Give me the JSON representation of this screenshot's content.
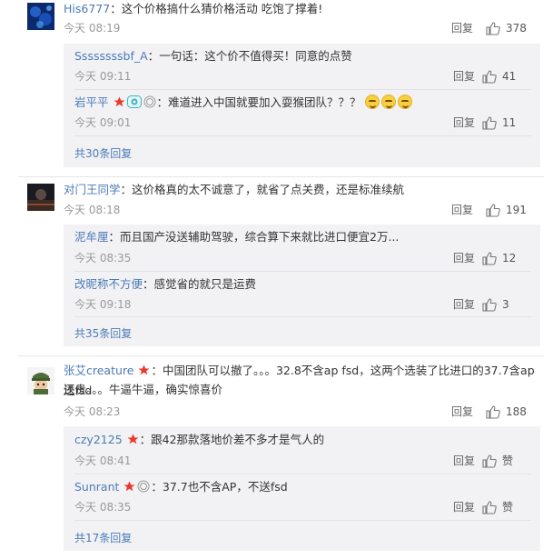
{
  "ui": {
    "reply_label": "回复",
    "zan_label": "赞"
  },
  "comments": [
    {
      "user": "His6777",
      "text": "这个价格搞什么猜价格活动 吃饱了撑着!",
      "time": "今天 08:19",
      "likes": "378",
      "replies": [
        {
          "user": "Ssssssssbf_A",
          "text": "一句话：这个价不值得买！同意的点赞",
          "time": "今天 09:11",
          "likes": "41"
        },
        {
          "user": "岩平平",
          "text": "难道进入中国就要加入耍猴团队？？？",
          "time": "今天 09:01",
          "likes": "11"
        }
      ],
      "more_replies": "共30条回复"
    },
    {
      "user": "对门王同学",
      "text": "这价格真的太不诚意了，就省了点关费，还是标准续航",
      "time": "今天 08:18",
      "likes": "191",
      "replies": [
        {
          "user": "泥牟厘",
          "text": "而且国产没送辅助驾驶，综合算下来就比进口便宜2万...",
          "time": "今天 08:35",
          "likes": "12"
        },
        {
          "user": "改昵称不方便",
          "text": "感觉省的就只是运费",
          "time": "今天 09:18",
          "likes": "3"
        }
      ],
      "more_replies": "共35条回复"
    },
    {
      "user": "张艾creature",
      "text_line1": "中国团队可以撤了。。。32.8不含ap fsd，这两个选装了比进口的37.7含ap送fsd",
      "text_line2": "还贵。。。牛逼牛逼，确实惊喜价",
      "time": "今天 08:23",
      "likes": "188",
      "replies": [
        {
          "user": "czy2125",
          "text": "跟42那款落地价差不多才是气人的",
          "time": "今天 08:41"
        },
        {
          "user": "Sunrant",
          "text": "37.7也不含AP，不送fsd",
          "time": "今天 08:35"
        }
      ],
      "more_replies": "共17条回复"
    }
  ],
  "colors": {
    "username": "#4a7bb5",
    "sub_bg": "#f2f2f5",
    "badge_red": "#e8392a"
  }
}
